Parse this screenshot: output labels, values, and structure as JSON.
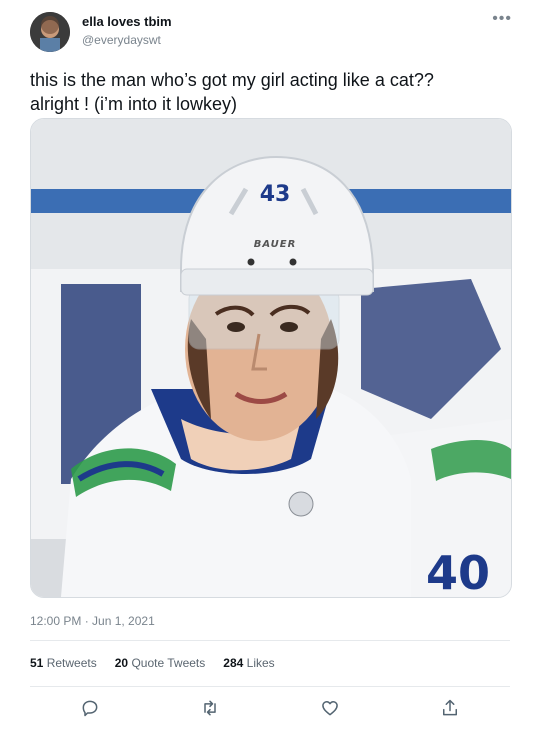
{
  "author": {
    "display_name": "ella loves tbim",
    "handle": "@everydayswt",
    "avatar_icon": "avatar-icon"
  },
  "more_icon": "more-icon",
  "tweet": {
    "text": "this is the man who’s got my girl acting like a cat??\nalright ! (i’m into it lowkey)",
    "timestamp": "12:00 PM · Jun 1, 2021"
  },
  "media": {
    "helmet_text": "43",
    "helmet_brand": "BAUER",
    "jersey_number": "40"
  },
  "stats": {
    "retweets_count": "51",
    "retweets_label": "Retweets",
    "quotes_count": "20",
    "quotes_label": "Quote Tweets",
    "likes_count": "284",
    "likes_label": "Likes"
  },
  "actions": [
    "reply-icon",
    "retweet-icon",
    "like-icon",
    "share-icon"
  ],
  "colors": {
    "text": "#0f1419",
    "secondary": "#7a848d",
    "divider": "#e6e9ec",
    "jersey_blue": "#1d3a8a",
    "jersey_green": "#2e9a4a"
  }
}
